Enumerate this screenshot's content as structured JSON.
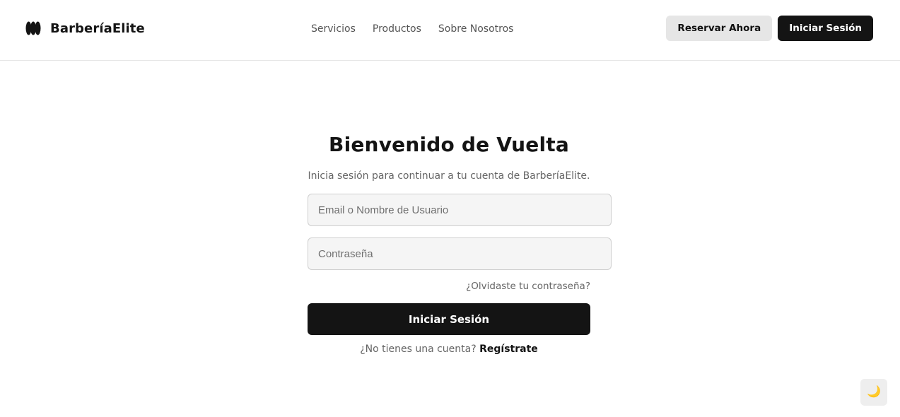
{
  "header": {
    "logo_icon": "barber-logo-icon",
    "brand": "BarberíaElite",
    "nav": [
      {
        "label": "Servicios"
      },
      {
        "label": "Productos"
      },
      {
        "label": "Sobre Nosotros"
      }
    ],
    "reserve_label": "Reservar Ahora",
    "login_label": "Iniciar Sesión"
  },
  "login": {
    "title": "Bienvenido de Vuelta",
    "subtitle": "Inicia sesión para continuar a tu cuenta de BarberíaElite.",
    "email": {
      "value": "",
      "placeholder": "Email o Nombre de Usuario"
    },
    "password": {
      "value": "",
      "placeholder": "Contraseña"
    },
    "forgot_label": "¿Olvidaste tu contraseña?",
    "submit_label": "Iniciar Sesión",
    "signup_prompt": "¿No tienes una cuenta?",
    "signup_link": "Regístrate"
  },
  "theme_toggle": {
    "icon": "moon-icon",
    "glyph": "🌙"
  },
  "colors": {
    "primary": "#141414",
    "secondary_button": "#e6e6e6",
    "input_background": "#f5f5f5",
    "muted_text": "#666666"
  }
}
